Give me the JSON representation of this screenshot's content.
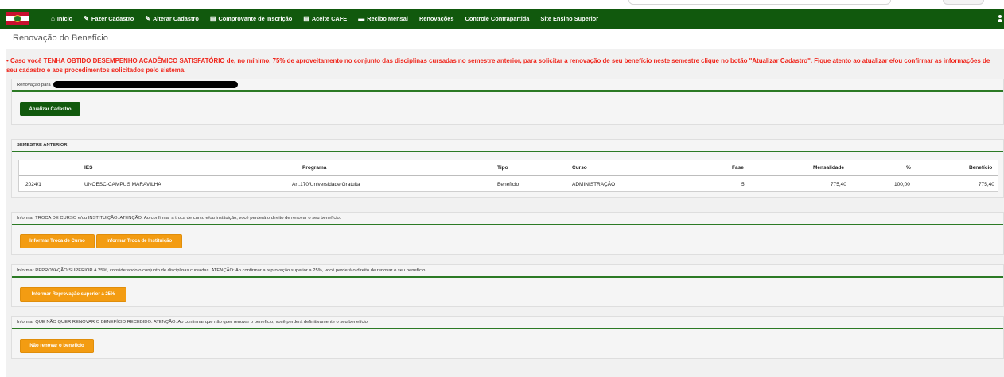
{
  "nav": {
    "items": [
      {
        "icon": "home-icon",
        "glyph": "⌂",
        "label": "Início"
      },
      {
        "icon": "edit-icon",
        "glyph": "✎",
        "label": "Fazer Cadastro"
      },
      {
        "icon": "edit-icon",
        "glyph": "✎",
        "label": "Alterar Cadastro"
      },
      {
        "icon": "document-icon",
        "glyph": "▤",
        "label": "Comprovante de Inscrição"
      },
      {
        "icon": "document-icon",
        "glyph": "▤",
        "label": "Aceite CAFE"
      },
      {
        "icon": "card-icon",
        "glyph": "▬",
        "label": "Recibo Mensal"
      },
      {
        "icon": "",
        "glyph": "",
        "label": "Renovações"
      },
      {
        "icon": "",
        "glyph": "",
        "label": "Controle Contrapartida"
      },
      {
        "icon": "",
        "glyph": "",
        "label": "Site Ensino Superior"
      }
    ]
  },
  "page": {
    "title": "Renovação do Benefício"
  },
  "alert": {
    "text": "• Caso você TENHA OBTIDO DESEMPENHO ACADÊMICO SATISFATÓRIO de, no mínimo, 75% de aproveitamento no conjunto das disciplinas cursadas no semestre anterior, para solicitar a renovação de seu benefício neste semestre clique no botão \"Atualizar Cadastro\". Fique atento ao atualizar e/ou confirmar as informações de seu cadastro e aos procedimentos solicitados pelo sistema."
  },
  "renovacao": {
    "label": "Renovação para",
    "button": "Atualizar Cadastro"
  },
  "semestre": {
    "heading": "SEMESTRE ANTERIOR",
    "columns": [
      "IES",
      "Programa",
      "Tipo",
      "Curso",
      "Fase",
      "Mensalidade",
      "%",
      "Benefício"
    ],
    "rows": [
      [
        "2024/1",
        "UNOESC-CAMPUS MARAVILHA",
        "Art.170/Universidade Gratuita",
        "Benefício",
        "ADMINISTRAÇÃO",
        "5",
        "775,40",
        "100,00",
        "775,40"
      ]
    ]
  },
  "troca": {
    "text": "Informar TROCA DE CURSO e/ou INSTITUIÇÃO. ATENÇÃO: Ao confirmar a troca de curso e/ou instituição, você perderá o direito de renovar o seu benefício.",
    "button_curso": "Informar Troca de Curso",
    "button_instituicao": "Informar Troca de Instituição"
  },
  "reprovacao": {
    "text": "Informar REPROVAÇÃO SUPERIOR A 25%, considerando o conjunto de disciplinas cursadas. ATENÇÃO: Ao confirmar a reprovação superior a 25%, você perderá o direito de renovar o seu benefício.",
    "button": "Informar Reprovação superior a 25%"
  },
  "nao_renovar": {
    "text": "Informar QUE NÃO QUER RENOVAR O BENEFÍCIO RECEBIDO. ATENÇÃO: Ao confirmar que não quer renovar o benefício, você perderá definitivamente o seu benefício.",
    "button": "Não renovar o benefício"
  },
  "colors": {
    "navbar": "#11590d",
    "alert": "#f0251b",
    "orange_button": "#f39c12",
    "section_rule": "#2c7a25"
  }
}
